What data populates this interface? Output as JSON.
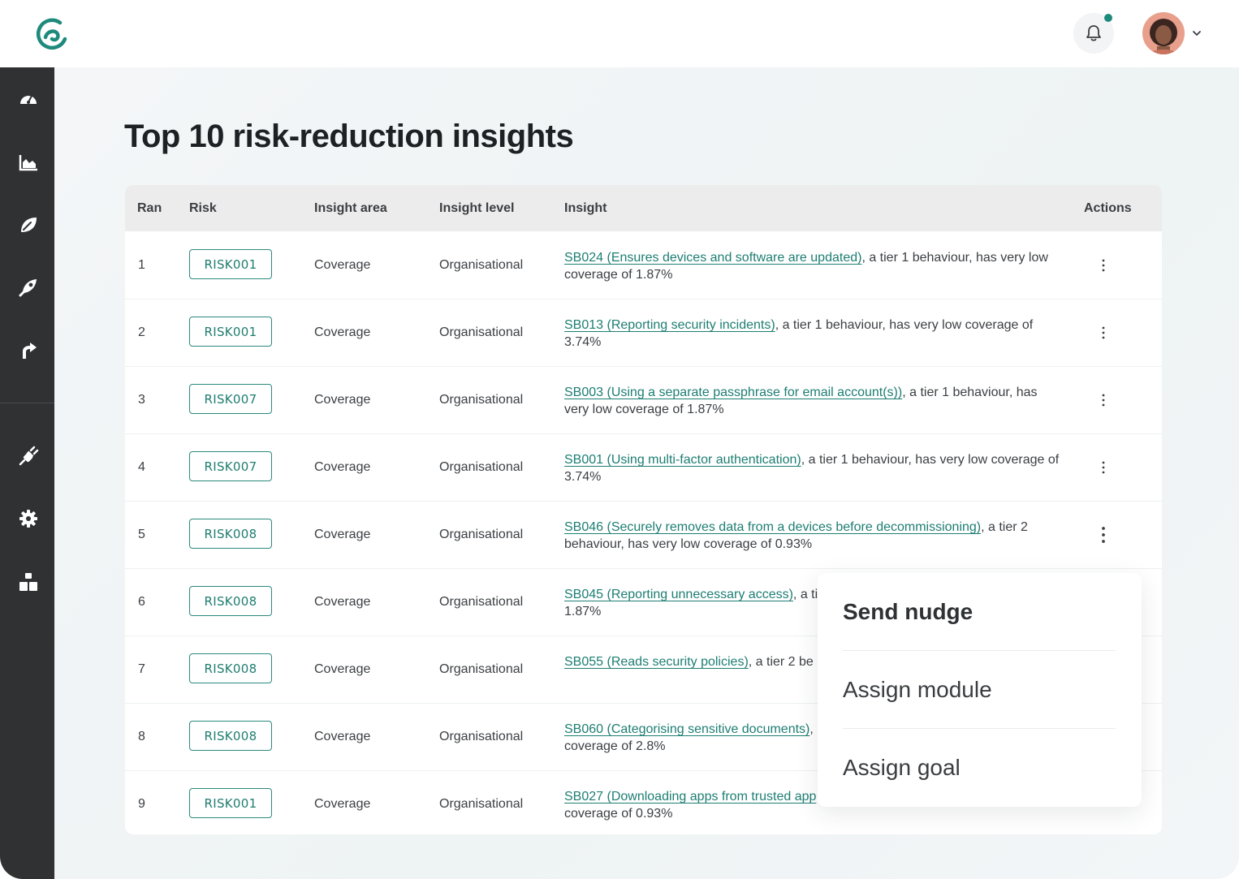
{
  "app": {
    "brand_color": "#1e8a7c"
  },
  "header": {
    "notification_indicator": true
  },
  "sidebar": {
    "items": [
      {
        "icon": "dashboard-gauge-icon"
      },
      {
        "icon": "area-chart-icon"
      },
      {
        "icon": "leaf-icon"
      },
      {
        "icon": "rocket-icon"
      },
      {
        "icon": "curved-arrow-icon"
      },
      {
        "icon": "plug-icon"
      },
      {
        "icon": "gear-icon"
      },
      {
        "icon": "org-chart-icon"
      }
    ]
  },
  "page": {
    "title": "Top 10 risk-reduction insights"
  },
  "table": {
    "columns": {
      "rank": "Ran",
      "risk": "Risk",
      "area": "Insight area",
      "level": "Insight level",
      "insight": "Insight",
      "actions": "Actions"
    },
    "rows": [
      {
        "rank": "1",
        "risk": "RISK001",
        "area": "Coverage",
        "level": "Organisational",
        "link": "SB024 (Ensures devices and software are updated)",
        "text": ", a tier 1 behaviour, has very low coverage of 1.87%"
      },
      {
        "rank": "2",
        "risk": "RISK001",
        "area": "Coverage",
        "level": "Organisational",
        "link": "SB013 (Reporting security incidents)",
        "text": ", a tier 1 behaviour, has very low coverage of 3.74%"
      },
      {
        "rank": "3",
        "risk": "RISK007",
        "area": "Coverage",
        "level": "Organisational",
        "link": "SB003 (Using a separate passphrase for email account(s))",
        "text": ", a tier 1 behaviour, has very low coverage of 1.87%"
      },
      {
        "rank": "4",
        "risk": "RISK007",
        "area": "Coverage",
        "level": "Organisational",
        "link": "SB001 (Using multi-factor authentication)",
        "text": ", a tier 1 behaviour, has very low coverage of 3.74%"
      },
      {
        "rank": "5",
        "risk": "RISK008",
        "area": "Coverage",
        "level": "Organisational",
        "link": "SB046 (Securely removes data from a devices before decommissioning)",
        "text": ", a tier 2 behaviour, has very low coverage of 0.93%"
      },
      {
        "rank": "6",
        "risk": "RISK008",
        "area": "Coverage",
        "level": "Organisational",
        "link": "SB045 (Reporting unnecessary access)",
        "text": ", a ti",
        "text2": "1.87%"
      },
      {
        "rank": "7",
        "risk": "RISK008",
        "area": "Coverage",
        "level": "Organisational",
        "link": "SB055 (Reads security policies)",
        "text": ", a tier 2 be"
      },
      {
        "rank": "8",
        "risk": "RISK008",
        "area": "Coverage",
        "level": "Organisational",
        "link": "SB060 (Categorising sensitive documents)",
        "text": ",",
        "text2": "coverage of 2.8%"
      },
      {
        "rank": "9",
        "risk": "RISK001",
        "area": "Coverage",
        "level": "Organisational",
        "link": "SB027 (Downloading apps from trusted app",
        "text": "",
        "text2": "coverage of 0.93%"
      }
    ]
  },
  "menu": {
    "items": [
      "Send nudge",
      "Assign module",
      "Assign goal"
    ]
  }
}
